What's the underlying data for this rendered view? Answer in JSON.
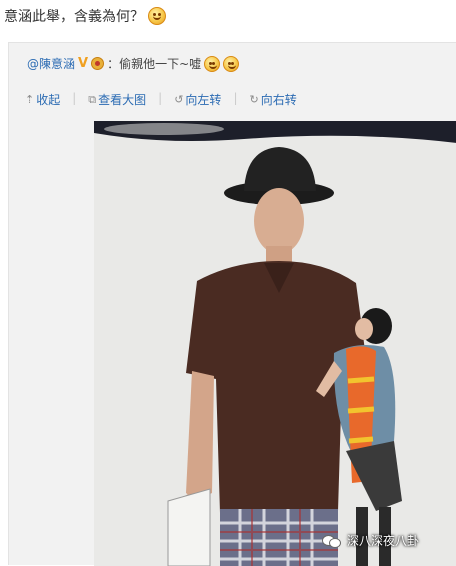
{
  "post": {
    "text": "意涵此舉，含義為何？",
    "emoji": "smile-emoji"
  },
  "repost": {
    "author": "@陳意涵",
    "verified_badge": "V",
    "quote": "：偷親他一下~噓",
    "emoji_count": 2
  },
  "toolbar": {
    "collapse": "收起",
    "view_large": "查看大图",
    "rotate_left": "向左转",
    "rotate_right": "向右转"
  },
  "watermark": {
    "text": "深八深夜八卦",
    "icon": "wechat-icon"
  },
  "colors": {
    "link_blue": "#2b6bb3",
    "repost_bg": "#f2f2f2",
    "shirt_brown": "#4a2b22",
    "scarf_orange": "#e8692b"
  }
}
